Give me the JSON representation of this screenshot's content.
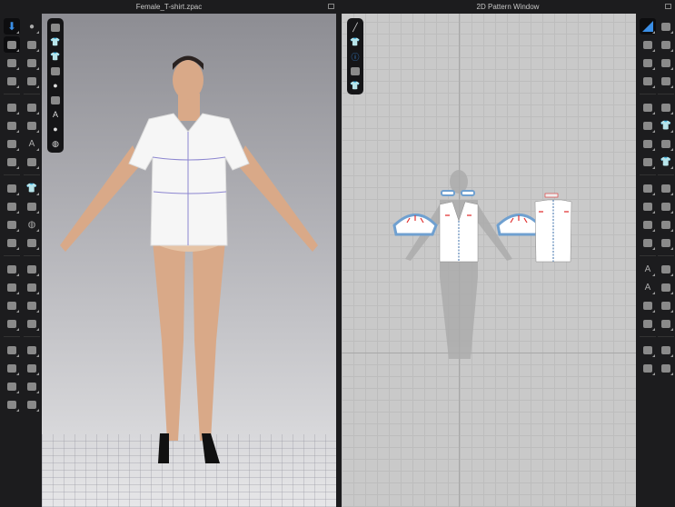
{
  "window_3d": {
    "title": "Female_T-shirt.zpac"
  },
  "window_2d": {
    "title": "2D Pattern Window"
  },
  "colors": {
    "accent": "#3a8ee6",
    "bg": "#1c1c1e",
    "pattern_bg": "#c9c9c9",
    "outline_blue": "#6fa0d0",
    "notch_red": "#e03030"
  },
  "left_toolbar_a": [
    "simulation-icon",
    "select-mesh-icon",
    "transform-icon",
    "fold-arrangement-icon",
    "pin-icon",
    "tack-icon",
    "measure-icon",
    "strap-icon",
    "brush-icon",
    "arrange-icon",
    "gather-icon",
    "zipper-icon",
    "piping-icon",
    "button-icon",
    "buttonhole-icon",
    "topstitch-icon",
    "puckering-icon",
    "tape-icon",
    "fitting-icon",
    "garment-icon"
  ],
  "left_toolbar_b": [
    "avatar-pose-icon",
    "garment-tools-icon",
    "sewing-icon",
    "pattern-icon",
    "fold-icon",
    "unfold-icon",
    "texture-icon",
    "line-icon",
    "shirt-icon",
    "hanger-icon",
    "globe-icon",
    "trim-icon",
    "pants-icon",
    "dress-icon",
    "overlay-icon",
    "skirt-icon",
    "layer-icon",
    "panel-icon",
    "crop-icon",
    "stamp-icon"
  ],
  "viewport_3d_toolbar": [
    "box-icon",
    "shirt-box-icon",
    "shirt-icon",
    "nodes-icon",
    "avatar-icon",
    "fabric-icon",
    "texture-icon",
    "avatar-skin-icon",
    "globe-icon"
  ],
  "viewport_2d_toolbar": [
    "pen-icon",
    "shirt-icon",
    "info-icon",
    "fabric-icon",
    "shirt-2-icon"
  ],
  "right_toolbar_a": [
    "edit-pattern-icon",
    "polygon-icon",
    "segment-icon",
    "rectangle-icon",
    "internal-polygon-icon",
    "internal-rect-icon",
    "trace-icon",
    "cut-icon",
    "notch-icon",
    "dart-icon",
    "mirror-icon",
    "grain-icon",
    "text-icon",
    "text-size-icon",
    "grading-icon",
    "tape-measure-icon",
    "pin-2d-icon",
    "fabric-2d-icon"
  ],
  "right_toolbar_b": [
    "sew-icon",
    "sew-segment-icon",
    "sew-free-icon",
    "sew-multi-icon",
    "iron-icon",
    "shirt-3-icon",
    "brush-2-icon",
    "shirt-4-icon",
    "puckering-2-icon",
    "elastic-icon",
    "seam-icon",
    "fold-2-icon",
    "stitch-icon",
    "zip-icon",
    "grid-icon",
    "pattern-list-icon",
    "split-icon",
    "table-icon"
  ]
}
